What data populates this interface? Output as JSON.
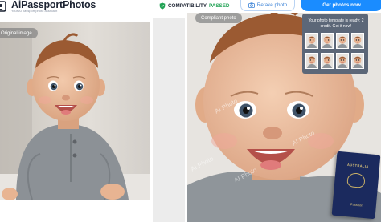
{
  "header": {
    "brand_name": "AiPassportPhotos",
    "brand_tagline": "Your AI passport photo assistant",
    "compatibility_label": "COMPATIBILITY",
    "compatibility_status": "PASSED",
    "retake_label": "Retake photo",
    "get_photos_label": "Get photos now"
  },
  "panels": {
    "original_label": "Original image",
    "compliant_label": "Compliant photo",
    "watermark": "AI Photo"
  },
  "popup": {
    "message": "Your photo template is ready: 2 credit. Get it now!"
  },
  "passport": {
    "country": "AUSTRALIA",
    "word": "Passport"
  },
  "colors": {
    "accent_blue": "#1a8cff",
    "pass_green": "#22a355",
    "passport_navy": "#1b2a5e"
  }
}
